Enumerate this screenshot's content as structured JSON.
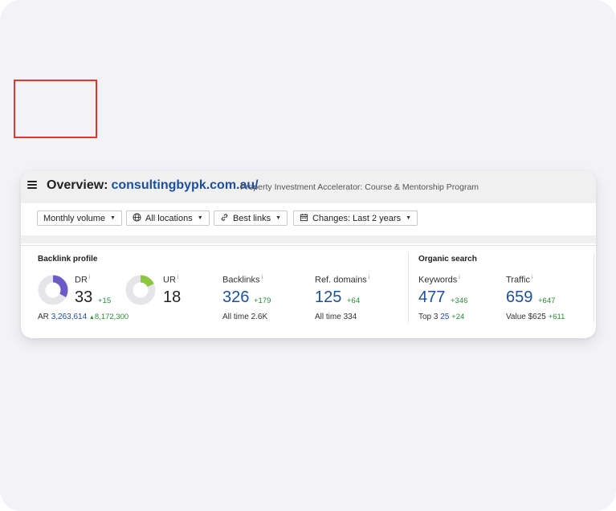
{
  "header": {
    "overview_label": "Overview:",
    "domain": "consultingbypk.com.au/",
    "description": "Property Investment Accelerator: Course & Mentorship Program"
  },
  "filters": {
    "volume": "Monthly volume",
    "locations": "All locations",
    "links": "Best links",
    "changes": "Changes: Last 2 years"
  },
  "backlink_profile": {
    "title": "Backlink profile",
    "dr": {
      "label": "DR",
      "value": "33",
      "delta": "+15",
      "percent": 33
    },
    "ur": {
      "label": "UR",
      "value": "18",
      "percent": 18
    },
    "ar": {
      "label": "AR",
      "value": "3,263,614",
      "delta": "8,172,300"
    },
    "backlinks": {
      "label": "Backlinks",
      "value": "326",
      "delta": "+179",
      "sub_label": "All time",
      "sub_value": "2.6K"
    },
    "ref_domains": {
      "label": "Ref. domains",
      "value": "125",
      "delta": "+64",
      "sub_label": "All time",
      "sub_value": "334"
    }
  },
  "organic_search": {
    "title": "Organic search",
    "keywords": {
      "label": "Keywords",
      "value": "477",
      "delta": "+346",
      "sub_label": "Top 3",
      "sub_value": "25",
      "sub_delta": "+24"
    },
    "traffic": {
      "label": "Traffic",
      "value": "659",
      "delta": "+647",
      "sub_label": "Value",
      "sub_value": "$625",
      "sub_delta": "+611"
    }
  },
  "colors": {
    "accent": "#1d4fa0",
    "dr_donut": "#6b5bc9",
    "ur_donut": "#8dc63f",
    "highlight": "#e0392b",
    "positive": "#2a8d3a"
  }
}
